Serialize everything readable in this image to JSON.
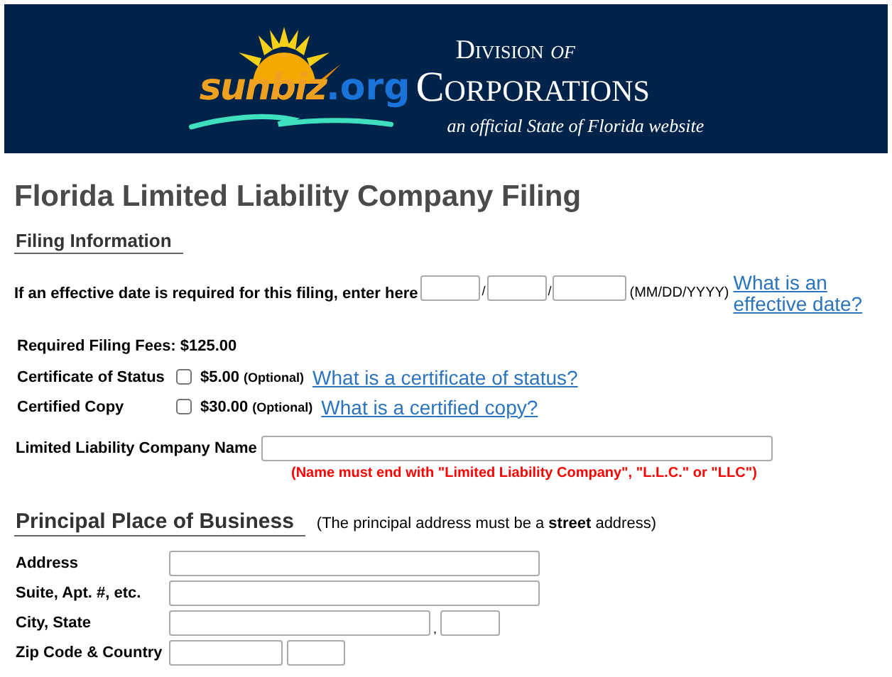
{
  "banner": {
    "logo_word": "sunbiz",
    "logo_domain": ".org",
    "division": "Division *of*",
    "corporations": "Corporations",
    "tagline": "an official State of Florida website"
  },
  "title": "Florida Limited Liability Company Filing",
  "filing_section": {
    "heading": "Filing Information",
    "effective_date": {
      "label": "If an effective date is required for this filing, enter here",
      "parts": [
        {
          "kind": "month",
          "separator": "/"
        },
        {
          "kind": "day",
          "separator": "/"
        },
        {
          "kind": "year"
        }
      ],
      "format": "(MM/DD/YYYY)",
      "help_link": "What is an effective date?"
    },
    "fees": "Required Filing Fees: $125.00",
    "options": [
      {
        "label": "Certificate of Status",
        "checked": false,
        "price": "$5.00",
        "note": "(Optional)",
        "help_link": "What is a certificate of status?"
      },
      {
        "label": "Certified Copy",
        "checked": false,
        "price": "$30.00",
        "note": "(Optional)",
        "help_link": "What is a certified copy?"
      }
    ],
    "name_label": "Limited Liability Company Name",
    "name_note": "(Name must end with \"Limited Liability Company\", \"L.L.C.\" or \"LLC\")"
  },
  "principal_section": {
    "heading": "Principal Place of Business",
    "note": "(The principal address must be a **street** address)",
    "rows": [
      {
        "label": "Address",
        "fields": [
          {
            "kind": "long"
          }
        ]
      },
      {
        "label": "Suite, Apt. #, etc.",
        "fields": [
          {
            "kind": "long"
          }
        ]
      },
      {
        "label": "City, State",
        "fields": [
          {
            "kind": "city",
            "separator": ","
          },
          {
            "kind": "state"
          }
        ]
      },
      {
        "label": "Zip Code & Country",
        "fields": [
          {
            "kind": "zip"
          },
          {
            "kind": "country"
          }
        ]
      }
    ]
  }
}
